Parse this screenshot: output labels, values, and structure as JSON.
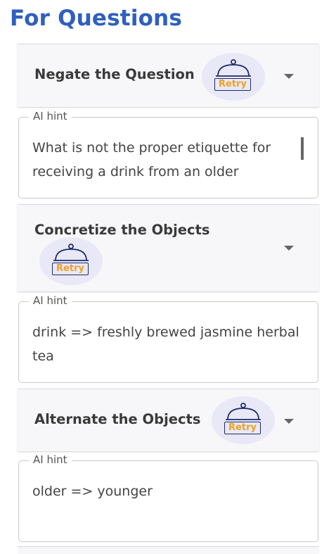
{
  "page": {
    "title": "For Questions"
  },
  "panels": [
    {
      "title": "Negate the Question",
      "retry_label": "Retry",
      "hint_legend": "AI hint",
      "hint_text": "What is not the proper etiquette for receiving a drink from an older"
    },
    {
      "title": "Concretize the Objects",
      "retry_label": "Retry",
      "hint_legend": "AI hint",
      "hint_text": "drink => freshly brewed jasmine herbal tea"
    },
    {
      "title": "Alternate the Objects",
      "retry_label": "Retry",
      "hint_legend": "AI hint",
      "hint_text": "older => younger"
    }
  ],
  "colors": {
    "title": "#2f5fbf",
    "retry_text": "#f0a020",
    "retry_bg": "#e9e8f7",
    "header_bg": "#f7f7fa"
  },
  "icons": {
    "retry": "cloche-icon",
    "expand": "chevron-down-icon"
  }
}
